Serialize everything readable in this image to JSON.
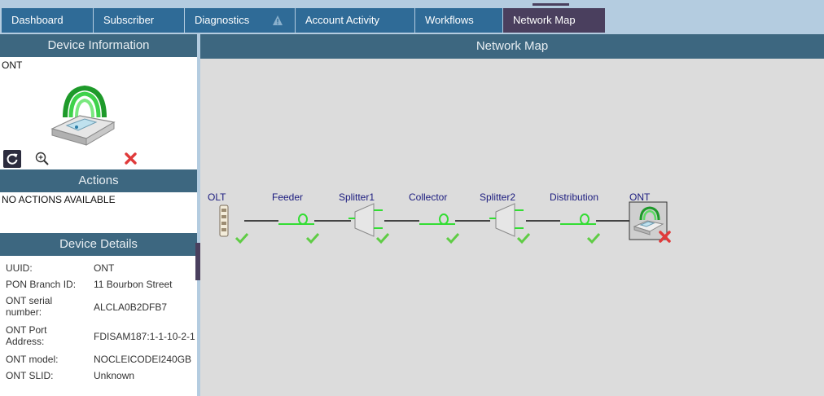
{
  "tabs": [
    {
      "label": "Dashboard"
    },
    {
      "label": "Subscriber"
    },
    {
      "label": "Diagnostics"
    },
    {
      "label": "Account Activity"
    },
    {
      "label": "Workflows"
    },
    {
      "label": "Network Map",
      "active": true
    }
  ],
  "device_info": {
    "title": "Device Information",
    "device_type": "ONT",
    "icon": "wireless-router-icon"
  },
  "actions": {
    "title": "Actions",
    "empty_text": "NO ACTIONS AVAILABLE"
  },
  "device_details": {
    "title": "Device Details",
    "rows": [
      {
        "label": "UUID:",
        "value": "ONT"
      },
      {
        "label": "PON Branch ID:",
        "value": "11 Bourbon Street"
      },
      {
        "label": "ONT serial number:",
        "value": "ALCLA0B2DFB7"
      },
      {
        "label": "ONT Port Address:",
        "value": "FDISAM187:1-1-10-2-1"
      },
      {
        "label": "ONT model:",
        "value": "NOCLEICODEI240GB"
      },
      {
        "label": "ONT SLID:",
        "value": "Unknown"
      }
    ]
  },
  "network_map": {
    "title": "Network Map",
    "nodes": [
      {
        "label": "OLT",
        "type": "olt",
        "status": "ok"
      },
      {
        "label": "Feeder",
        "type": "fiber",
        "status": "ok"
      },
      {
        "label": "Splitter1",
        "type": "splitter",
        "status": "ok"
      },
      {
        "label": "Collector",
        "type": "fiber",
        "status": "ok"
      },
      {
        "label": "Splitter2",
        "type": "splitter",
        "status": "ok"
      },
      {
        "label": "Distribution",
        "type": "fiber",
        "status": "ok"
      },
      {
        "label": "ONT",
        "type": "ont",
        "status": "error"
      }
    ]
  },
  "colors": {
    "tab": "#2f6b97",
    "tab_active": "#4a3f5e",
    "panel_header": "#3d6780",
    "fiber": "#33dd33",
    "ok": "#44bb33",
    "error": "#dd3333"
  }
}
